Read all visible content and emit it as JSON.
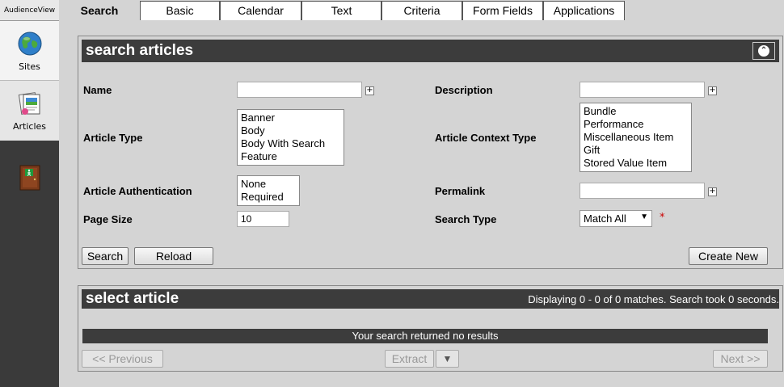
{
  "app": {
    "brand": "AudienceView"
  },
  "sidebar": {
    "items": [
      {
        "label": "Sites"
      },
      {
        "label": "Articles"
      }
    ]
  },
  "tabs": [
    {
      "label": "Search",
      "active": true
    },
    {
      "label": "Basic"
    },
    {
      "label": "Calendar"
    },
    {
      "label": "Text"
    },
    {
      "label": "Criteria"
    },
    {
      "label": "Form Fields"
    },
    {
      "label": "Applications"
    }
  ],
  "search_panel": {
    "title": "search articles",
    "fields": {
      "name": {
        "label": "Name",
        "value": ""
      },
      "description": {
        "label": "Description",
        "value": ""
      },
      "article_type": {
        "label": "Article Type",
        "options": [
          "Banner",
          "Body",
          "Body With Search",
          "Feature"
        ]
      },
      "article_context_type": {
        "label": "Article Context Type",
        "options": [
          "Bundle",
          "Performance",
          "Miscellaneous Item",
          "Gift",
          "Stored Value Item"
        ]
      },
      "article_authentication": {
        "label": "Article Authentication",
        "options": [
          "None",
          "Required"
        ]
      },
      "permalink": {
        "label": "Permalink",
        "value": ""
      },
      "page_size": {
        "label": "Page Size",
        "value": "10"
      },
      "search_type": {
        "label": "Search Type",
        "value": "Match All",
        "required_mark": "*"
      }
    },
    "buttons": {
      "search": "Search",
      "reload": "Reload",
      "create_new": "Create New"
    }
  },
  "results_panel": {
    "title": "select article",
    "match_info": "Displaying 0 - 0 of 0 matches. Search took 0 seconds.",
    "no_results": "Your search returned no results",
    "buttons": {
      "previous": "<< Previous",
      "extract": "Extract",
      "extract_menu": "▼",
      "next": "Next >>"
    }
  },
  "colors": {
    "header_bar": "#3c3c3c",
    "sidebar": "#3a3a3a",
    "background": "#d4d4d4",
    "required": "#cc0000"
  }
}
